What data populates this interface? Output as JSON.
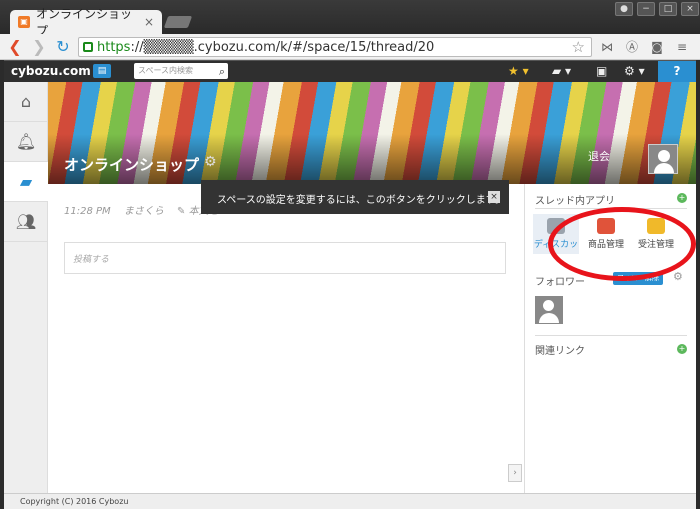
{
  "browser": {
    "tab_title": "オンラインショップ",
    "tab_close": "×",
    "url_scheme": "https",
    "url_rest": "://▒▒▒▒▒.cybozu.com/k/#/space/15/thread/20",
    "controls": [
      "−",
      "□",
      "×"
    ]
  },
  "appbar": {
    "logo": "cybozu.com",
    "search_placeholder": "スペース内検索",
    "help_label": "?"
  },
  "space": {
    "title": "オンラインショップ",
    "leave_label": "退会"
  },
  "thread": {
    "time": "11:28 PM",
    "author": "まさくら",
    "edit_label": "本文を",
    "post_placeholder": "投稿する"
  },
  "tooltip": {
    "text": "スペースの設定を変更するには、このボタンをクリックします。",
    "close": "×"
  },
  "sidebar": {
    "apps_heading": "スレッド内アプリ",
    "apps": [
      {
        "label": "ディスカッ",
        "color": "#9aa3ad"
      },
      {
        "label": "商品管理",
        "color": "#e0533a"
      },
      {
        "label": "受注管理",
        "color": "#f0b92a"
      }
    ],
    "followers_heading": "フォロワー",
    "unfollow_label": "フォロー解除",
    "links_heading": "関連リンク"
  },
  "footer": {
    "copyright": "Copyright (C) 2016 Cybozu"
  },
  "colors": {
    "accent": "#2a8fd1",
    "highlight": "#e8141b"
  }
}
